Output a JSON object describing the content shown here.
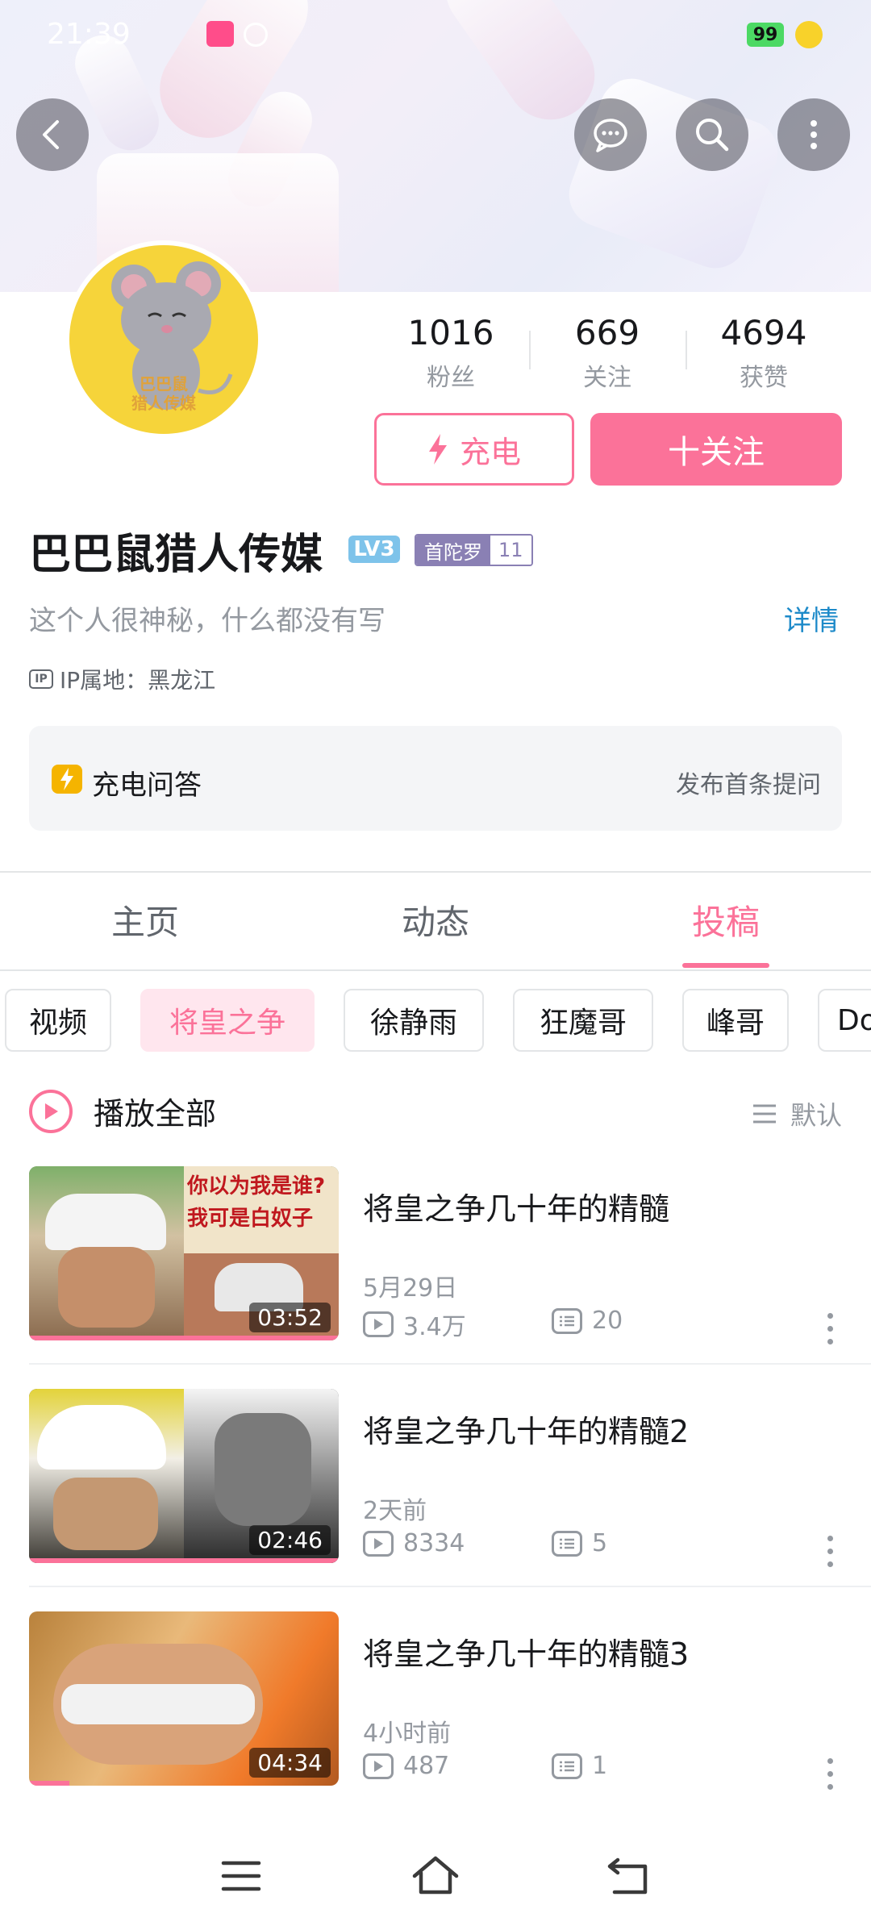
{
  "status": {
    "time": "21:39",
    "battery": "99"
  },
  "profile": {
    "name": "巴巴鼠猎人传媒",
    "level": "LV3",
    "medal_name": "首陀罗",
    "medal_level": "11",
    "bio": "这个人很神秘，什么都没有写",
    "detail_link": "详情",
    "ip_location": "IP属地：黑龙江",
    "avatar_text_line1": "巴巴鼠",
    "avatar_text_line2": "猎人传媒"
  },
  "stats": [
    {
      "value": "1016",
      "label": "粉丝"
    },
    {
      "value": "669",
      "label": "关注"
    },
    {
      "value": "4694",
      "label": "获赞"
    }
  ],
  "buttons": {
    "charge": "充电",
    "follow": "十关注"
  },
  "qa": {
    "title": "充电问答",
    "action": "发布首条提问"
  },
  "tabs": [
    "主页",
    "动态",
    "投稿"
  ],
  "chips": [
    "视频",
    "将皇之争",
    "徐静雨",
    "狂魔哥",
    "峰哥",
    "Do"
  ],
  "list_header": {
    "play_all": "播放全部",
    "sort": "默认"
  },
  "videos": [
    {
      "title": "将皇之争几十年的精髓",
      "date": "5月29日",
      "views": "3.4万",
      "comments": "20",
      "duration": "03:52",
      "progress": 1.0,
      "thumb_text1": "你以为我是谁?",
      "thumb_text2": "我可是白奴子"
    },
    {
      "title": "将皇之争几十年的精髓2",
      "date": "2天前",
      "views": "8334",
      "comments": "5",
      "duration": "02:46",
      "progress": 1.0
    },
    {
      "title": "将皇之争几十年的精髓3",
      "date": "4小时前",
      "views": "487",
      "comments": "1",
      "duration": "04:34",
      "progress": 0.13
    }
  ],
  "colors": {
    "accent": "#fb7299",
    "link": "#1d8ac9",
    "gray": "#9499a0"
  }
}
